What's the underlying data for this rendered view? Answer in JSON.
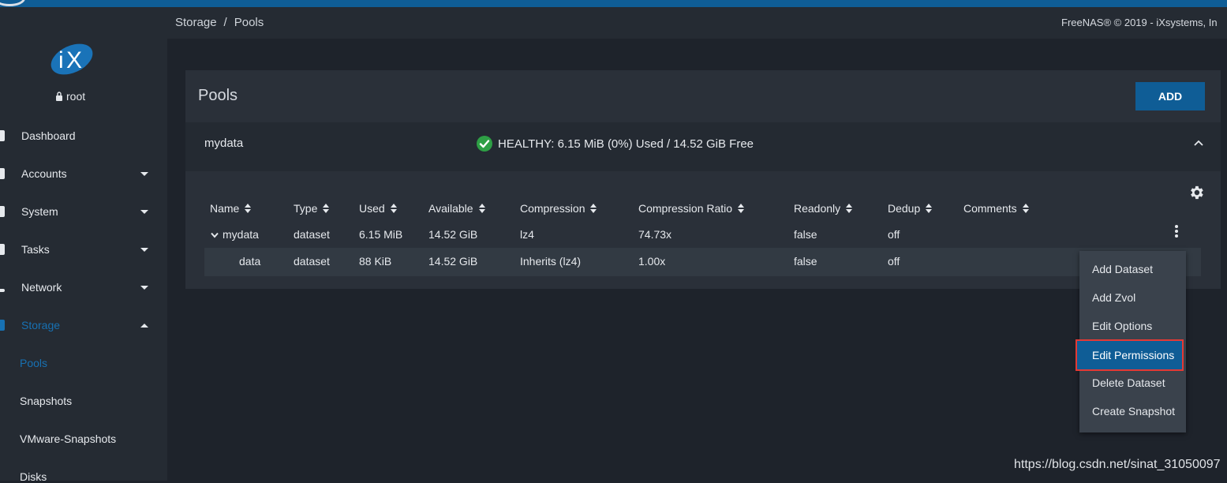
{
  "header": {
    "breadcrumb": [
      "Storage",
      "Pools"
    ],
    "breadcrumb_sep": "/",
    "copyright": "FreeNAS® © 2019 - iXsystems, In"
  },
  "sidebar": {
    "user": "root",
    "items": [
      {
        "label": "Dashboard",
        "expandable": false
      },
      {
        "label": "Accounts",
        "expandable": true
      },
      {
        "label": "System",
        "expandable": true
      },
      {
        "label": "Tasks",
        "expandable": true
      },
      {
        "label": "Network",
        "expandable": true
      },
      {
        "label": "Storage",
        "expandable": true,
        "active": true
      }
    ],
    "subitems": [
      {
        "label": "Pools",
        "active": true
      },
      {
        "label": "Snapshots"
      },
      {
        "label": "VMware-Snapshots"
      },
      {
        "label": "Disks"
      }
    ]
  },
  "card": {
    "title": "Pools",
    "add_label": "ADD",
    "pool": {
      "name": "mydata",
      "status": "HEALTHY: 6.15 MiB (0%) Used / 14.52 GiB Free"
    },
    "columns": [
      "Name",
      "Type",
      "Used",
      "Available",
      "Compression",
      "Compression Ratio",
      "Readonly",
      "Dedup",
      "Comments"
    ],
    "rows": [
      {
        "name": "mydata",
        "type": "dataset",
        "used": "6.15 MiB",
        "available": "14.52 GiB",
        "compression": "lz4",
        "ratio": "74.73x",
        "readonly": "false",
        "dedup": "off",
        "comments": ""
      },
      {
        "name": "data",
        "type": "dataset",
        "used": "88 KiB",
        "available": "14.52 GiB",
        "compression": "Inherits (lz4)",
        "ratio": "1.00x",
        "readonly": "false",
        "dedup": "off",
        "comments": ""
      }
    ]
  },
  "menu": {
    "items": [
      "Add Dataset",
      "Add Zvol",
      "Edit Options",
      "Edit Permissions",
      "Delete Dataset",
      "Create Snapshot"
    ],
    "highlighted": "Edit Permissions"
  },
  "watermark": "https://blog.csdn.net/sinat_31050097",
  "colors": {
    "accent": "#0f5d96",
    "active_nav": "#1771b3",
    "healthy": "#2e9f45",
    "highlight_border": "#e53935"
  }
}
